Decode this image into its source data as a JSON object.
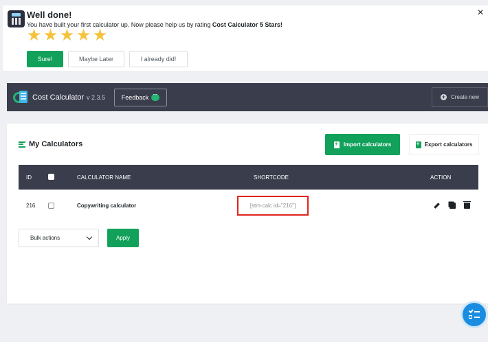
{
  "notice": {
    "title": "Well done!",
    "message_prefix": "You have built your first calculator up. Now please help us by rating ",
    "message_bold": "Cost Calculator 5 Stars!",
    "star_count": 5,
    "buttons": {
      "sure": "Sure!",
      "later": "Maybe Later",
      "did": "I already did!"
    },
    "close": "×"
  },
  "header": {
    "brand": "Cost Calculator",
    "version": "v 2.3.5",
    "feedback": "Feedback",
    "create_new": "Create new"
  },
  "main": {
    "title": "My Calculators",
    "import_label": "Import calculators",
    "export_label": "Export calculators",
    "columns": {
      "id": "ID",
      "name": "CALCULATOR NAME",
      "shortcode": "SHORTCODE",
      "action": "ACTION"
    },
    "rows": [
      {
        "id": "216",
        "name": "Copywriting calculator",
        "shortcode": "[stm-calc id=\"216\"]"
      }
    ],
    "bulk_label": "Bulk actions",
    "apply_label": "Apply"
  },
  "colors": {
    "accent": "#12a15a",
    "header_bg": "#3a3d4c",
    "highlight": "#e0241b",
    "fab": "#1b8de0"
  }
}
